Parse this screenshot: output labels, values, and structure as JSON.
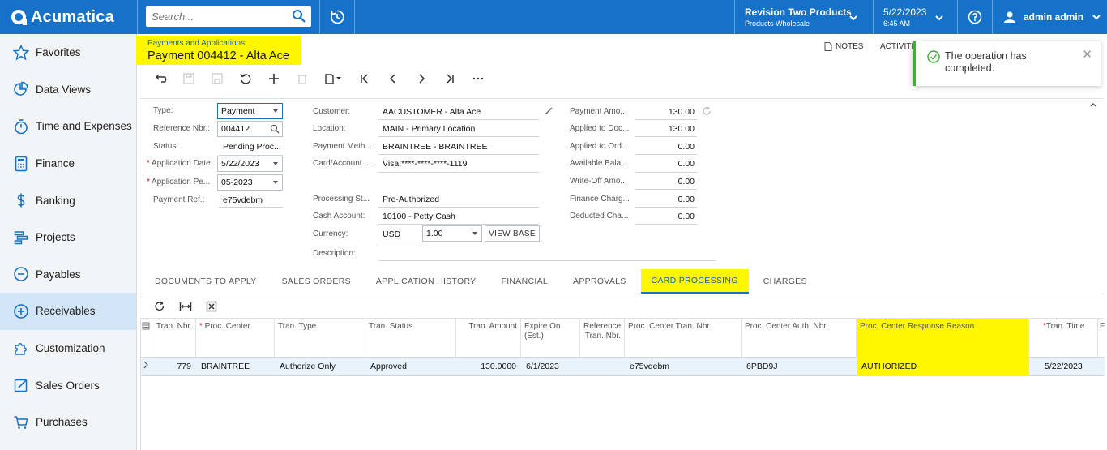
{
  "app": {
    "name": "Acumatica"
  },
  "search": {
    "placeholder": "Search..."
  },
  "company": {
    "name": "Revision Two Products",
    "branch": "Products Wholesale"
  },
  "datetime": {
    "date": "5/22/2023",
    "time": "6:45 AM"
  },
  "user": {
    "name": "admin admin"
  },
  "sidebar": {
    "items": [
      {
        "label": "Favorites",
        "icon": "star-icon"
      },
      {
        "label": "Data Views",
        "icon": "pie-chart-icon"
      },
      {
        "label": "Time and Expenses",
        "icon": "stopwatch-icon"
      },
      {
        "label": "Finance",
        "icon": "calculator-icon"
      },
      {
        "label": "Banking",
        "icon": "dollar-icon"
      },
      {
        "label": "Projects",
        "icon": "projects-icon"
      },
      {
        "label": "Payables",
        "icon": "minus-circle-icon"
      },
      {
        "label": "Receivables",
        "icon": "plus-circle-icon"
      },
      {
        "label": "Customization",
        "icon": "puzzle-icon"
      },
      {
        "label": "Sales Orders",
        "icon": "edit-icon"
      },
      {
        "label": "Purchases",
        "icon": "cart-icon"
      }
    ]
  },
  "page": {
    "breadcrumb": "Payments and Applications",
    "title": "Payment 004412 - Alta Ace",
    "notes_label": "NOTES",
    "activities_label": "ACTIVITI"
  },
  "toast": {
    "message": "The operation has completed."
  },
  "form": {
    "type": {
      "label": "Type:",
      "value": "Payment"
    },
    "reference_nbr": {
      "label": "Reference Nbr.:",
      "value": "004412"
    },
    "status": {
      "label": "Status:",
      "value": "Pending Proc..."
    },
    "application_date": {
      "label": "Application Date:",
      "value": "5/22/2023"
    },
    "application_period": {
      "label": "Application Pe...",
      "value": "05-2023"
    },
    "payment_ref": {
      "label": "Payment Ref.:",
      "value": "e75vdebm"
    },
    "customer": {
      "label": "Customer:",
      "value": "AACUSTOMER - Alta Ace"
    },
    "location": {
      "label": "Location:",
      "value": "MAIN - Primary Location"
    },
    "payment_method": {
      "label": "Payment Meth...",
      "value": "BRAINTREE - BRAINTREE"
    },
    "card_account": {
      "label": "Card/Account ...",
      "value": "Visa:****-****-****-1119"
    },
    "processing_status": {
      "label": "Processing St...",
      "value": "Pre-Authorized"
    },
    "cash_account": {
      "label": "Cash Account:",
      "value": "10100 - Petty Cash"
    },
    "currency": {
      "label": "Currency:",
      "value": "USD",
      "rate": "1.00",
      "view_base_label": "VIEW BASE"
    },
    "description": {
      "label": "Description:",
      "value": ""
    },
    "payment_amount": {
      "label": "Payment Amo...",
      "value": "130.00"
    },
    "applied_to_documents": {
      "label": "Applied to Doc...",
      "value": "130.00"
    },
    "applied_to_orders": {
      "label": "Applied to Ord...",
      "value": "0.00"
    },
    "available_balance": {
      "label": "Available Bala...",
      "value": "0.00"
    },
    "write_off_amount": {
      "label": "Write-Off Amo...",
      "value": "0.00"
    },
    "finance_charges": {
      "label": "Finance Charg...",
      "value": "0.00"
    },
    "deducted_charges": {
      "label": "Deducted Cha...",
      "value": "0.00"
    }
  },
  "tabs": [
    {
      "label": "DOCUMENTS TO APPLY"
    },
    {
      "label": "SALES ORDERS"
    },
    {
      "label": "APPLICATION HISTORY"
    },
    {
      "label": "FINANCIAL"
    },
    {
      "label": "APPROVALS"
    },
    {
      "label": "CARD PROCESSING"
    },
    {
      "label": "CHARGES"
    }
  ],
  "grid": {
    "columns": [
      {
        "label": "Tran. Nbr."
      },
      {
        "label": "Proc. Center",
        "required": true
      },
      {
        "label": "Tran. Type"
      },
      {
        "label": "Tran. Status"
      },
      {
        "label": "Tran. Amount"
      },
      {
        "label": "Expire On (Est.)"
      },
      {
        "label": "Reference Tran. Nbr."
      },
      {
        "label": "Proc. Center Tran. Nbr."
      },
      {
        "label": "Proc. Center Auth. Nbr."
      },
      {
        "label": "Proc. Center Response Reason"
      },
      {
        "label": "Tran. Time",
        "required": true
      },
      {
        "label": "F"
      }
    ],
    "rows": [
      {
        "tran_nbr": "779",
        "proc_center": "BRAINTREE",
        "tran_type": "Authorize Only",
        "tran_status": "Approved",
        "tran_amount": "130.0000",
        "expire_on": "6/1/2023",
        "reference_tran_nbr": "",
        "proc_center_tran_nbr": "e75vdebm",
        "proc_center_auth_nbr": "6PBD9J",
        "response_reason": "AUTHORIZED",
        "tran_time": "5/22/2023"
      }
    ]
  },
  "colors": {
    "brand": "#1572c8",
    "highlight": "#fff700",
    "success": "#3eb034"
  }
}
